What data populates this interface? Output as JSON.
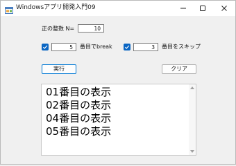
{
  "window": {
    "title": "Windowsアプリ開発入門09",
    "app_icon": "form-app-icon",
    "controls": [
      "minimize-icon",
      "maximize-icon",
      "close-icon"
    ]
  },
  "form": {
    "n_label": "正の整数 N=",
    "n_value": "10",
    "break_checked": true,
    "break_value": "5",
    "break_label": "番目でbreak",
    "skip_checked": true,
    "skip_value": "3",
    "skip_label": "番目をスキップ",
    "run_button": "実行",
    "clear_button": "クリア"
  },
  "output": {
    "lines": [
      "01番目の表示",
      "02番目の表示",
      "04番目の表示",
      "05番目の表示"
    ]
  },
  "colors": {
    "accent": "#0078d4",
    "checkbox": "#0b66c3"
  }
}
